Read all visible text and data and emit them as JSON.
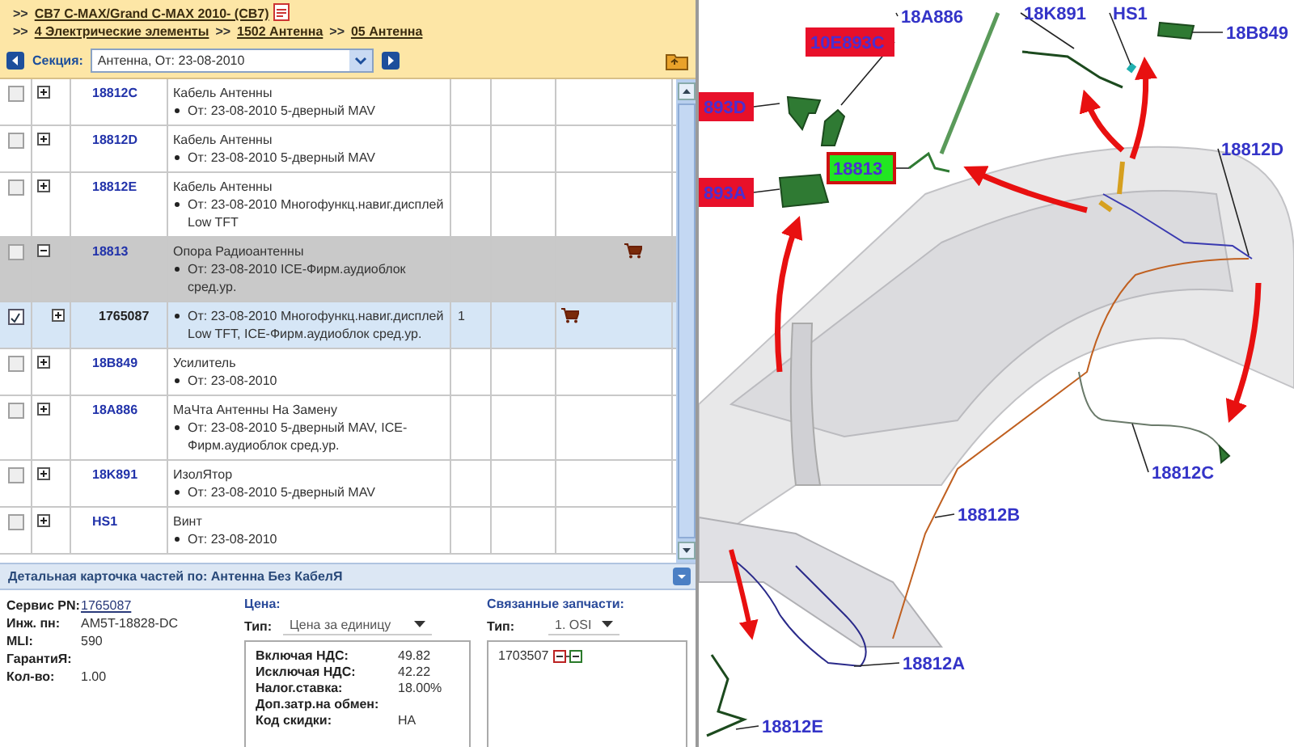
{
  "breadcrumbs": [
    {
      "prefix": ">>",
      "label": "CB7 C-MAX/Grand C-MAX 2010- (CB7)"
    },
    {
      "prefix": ">>",
      "label": "4 Электрические элементы"
    },
    {
      "prefix": ">>",
      "label": "1502 Антенна"
    },
    {
      "prefix": ">>",
      "label": "05 Антенна"
    }
  ],
  "section": {
    "label": "Секция:",
    "value": "Антенна, От: 23-08-2010"
  },
  "rows": [
    {
      "kind": "part",
      "checked": false,
      "expanded": false,
      "selected": false,
      "code": "18812C",
      "title": "Кабель Антенны",
      "notes": [
        "От: 23-08-2010 5-дверный MAV"
      ],
      "cart": false
    },
    {
      "kind": "part",
      "checked": false,
      "expanded": false,
      "selected": false,
      "code": "18812D",
      "title": "Кабель Антенны",
      "notes": [
        "От: 23-08-2010 5-дверный MAV"
      ],
      "cart": false
    },
    {
      "kind": "part",
      "checked": false,
      "expanded": false,
      "selected": false,
      "code": "18812E",
      "title": "Кабель Антенны",
      "notes": [
        "От: 23-08-2010 Многофункц.навиг.дисплей Low TFT"
      ],
      "cart": false
    },
    {
      "kind": "part",
      "checked": false,
      "expanded": true,
      "selected": false,
      "code": "18813",
      "title": "Опора Радиоантенны",
      "notes": [
        "От: 23-08-2010 ICE-Фирм.аудиоблок сред.ур."
      ],
      "cart": true
    },
    {
      "kind": "variant",
      "checked": true,
      "expanded": false,
      "selected": true,
      "code": "1765087",
      "notes": [
        "От: 23-08-2010 Многофункц.навиг.дисплей Low TFT, ICE-Фирм.аудиоблок сред.ур."
      ],
      "qty": "1",
      "cart": true
    },
    {
      "kind": "part",
      "checked": false,
      "expanded": false,
      "selected": false,
      "code": "18B849",
      "title": "Усилитель",
      "notes": [
        "От: 23-08-2010"
      ],
      "cart": false
    },
    {
      "kind": "part",
      "checked": false,
      "expanded": false,
      "selected": false,
      "code": "18A886",
      "title": "МаЧта Антенны На Замену",
      "notes": [
        "От: 23-08-2010 5-дверный MAV,  ICE-Фирм.аудиоблок сред.ур."
      ],
      "cart": false
    },
    {
      "kind": "part",
      "checked": false,
      "expanded": false,
      "selected": false,
      "code": "18K891",
      "title": "ИзолЯтор",
      "notes": [
        "От: 23-08-2010 5-дверный MAV"
      ],
      "cart": false
    },
    {
      "kind": "part",
      "checked": false,
      "expanded": false,
      "selected": false,
      "code": "HS1",
      "title": "Винт",
      "notes": [
        "От: 23-08-2010"
      ],
      "cart": false
    }
  ],
  "details": {
    "title": "Детальная карточка частей по: Антенна Без КабелЯ",
    "fields": [
      {
        "label": "Сервис PN:",
        "value": "1765087",
        "link": true
      },
      {
        "label": "Инж. пн:",
        "value": "AM5T-18828-DC"
      },
      {
        "label": "MLI:",
        "value": "590"
      },
      {
        "label": "ГарантиЯ:"
      },
      {
        "label": "Кол-во:",
        "value": "1.00"
      }
    ],
    "price": {
      "title": "Цена:",
      "type_label": "Тип:",
      "type_value": "Цена за единицу",
      "rows": [
        {
          "label": "Включая НДС:",
          "value": "49.82"
        },
        {
          "label": "Исключая НДС:",
          "value": "42.22"
        },
        {
          "label": "Налог.ставка:",
          "value": "18.00%"
        },
        {
          "label": "Доп.затр.на обмен:"
        },
        {
          "label": "Код скидки:",
          "value": "НА"
        }
      ]
    },
    "related": {
      "title": "Связанные запчасти:",
      "type_label": "Тип:",
      "type_value": "1. OSI",
      "items": [
        "1703507"
      ]
    }
  },
  "diagram": {
    "labels": [
      {
        "text": "18A886",
        "kind": "plain"
      },
      {
        "text": "18K891",
        "kind": "plain"
      },
      {
        "text": "HS1",
        "kind": "plain"
      },
      {
        "text": "18B849",
        "kind": "plain"
      },
      {
        "text": "10E893C",
        "kind": "tag",
        "color": "#e8102a"
      },
      {
        "text": "893D",
        "kind": "tag",
        "color": "#e8102a"
      },
      {
        "text": "893A",
        "kind": "tag",
        "color": "#e8102a"
      },
      {
        "text": "18813",
        "kind": "tag",
        "color": "#22e622"
      },
      {
        "text": "18812D",
        "kind": "plain"
      },
      {
        "text": "18812C",
        "kind": "plain"
      },
      {
        "text": "18812B",
        "kind": "plain"
      },
      {
        "text": "18812A",
        "kind": "plain"
      },
      {
        "text": "18812E",
        "kind": "plain"
      }
    ]
  }
}
